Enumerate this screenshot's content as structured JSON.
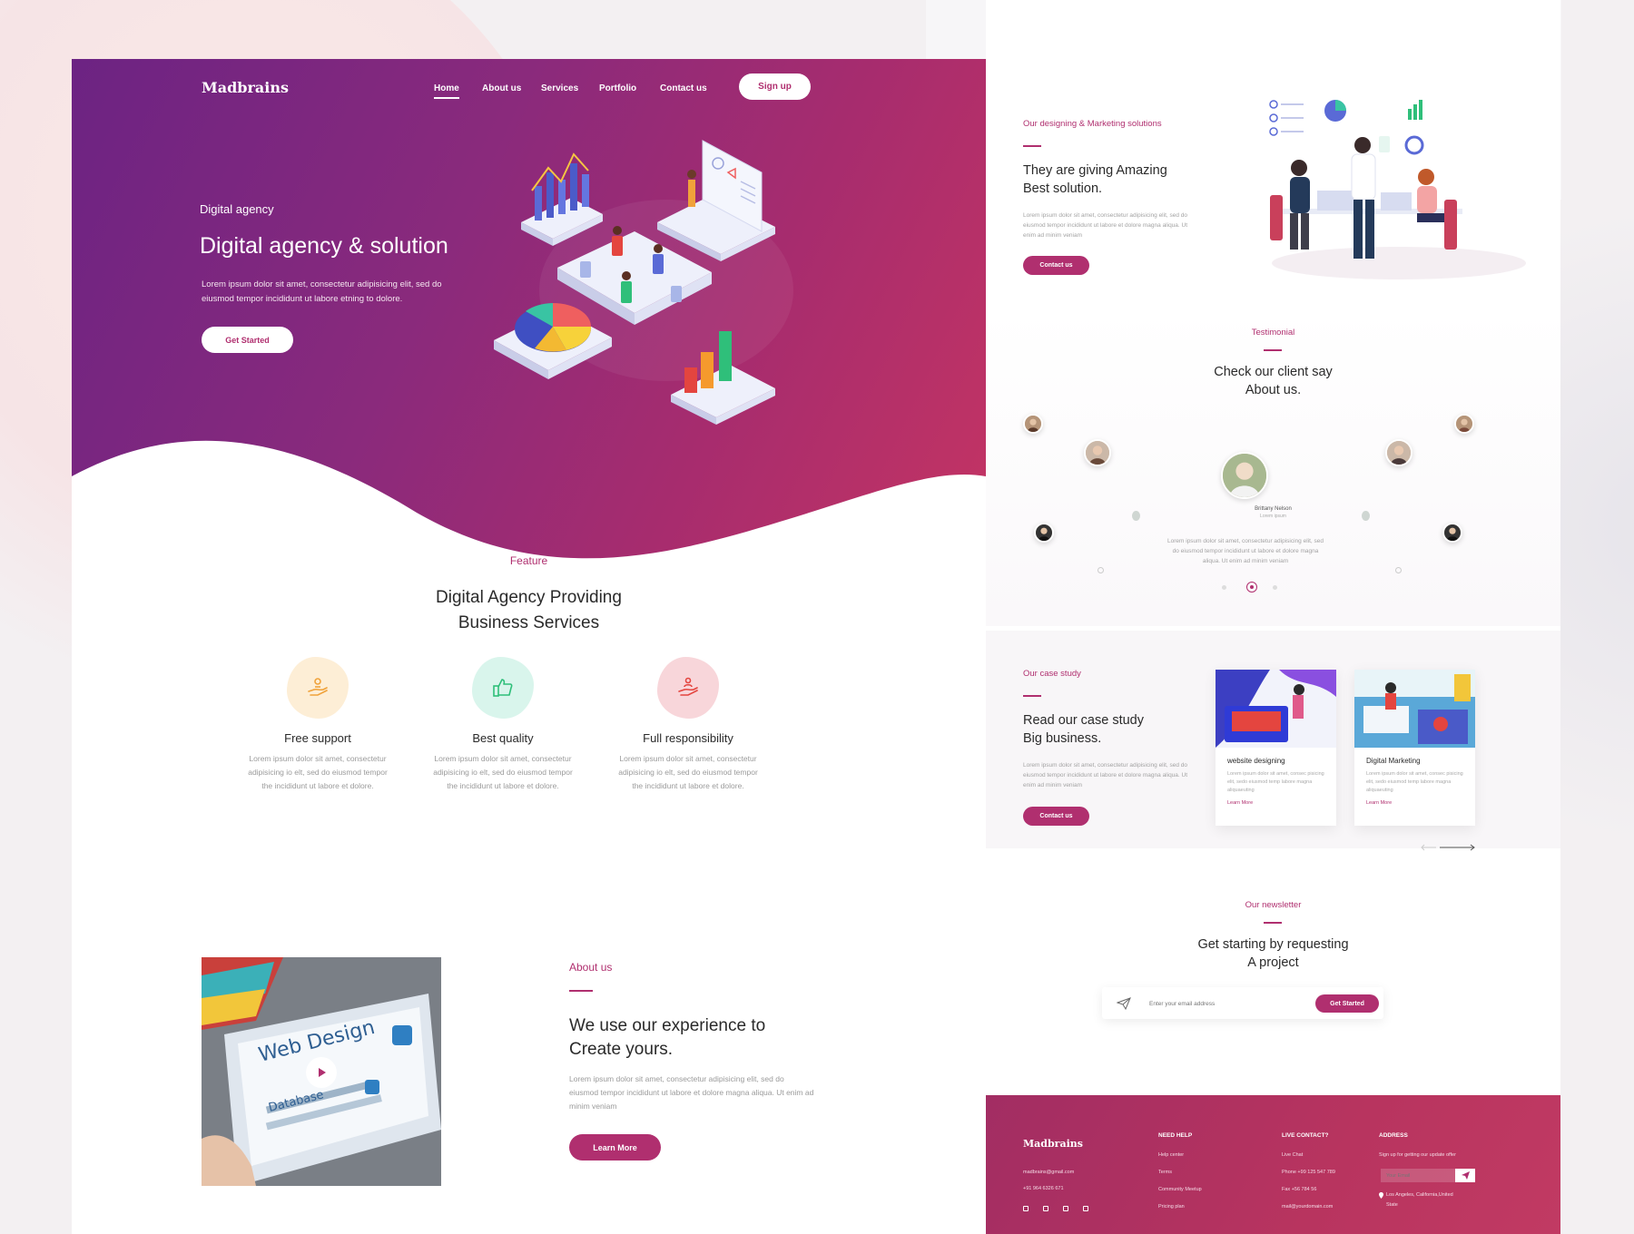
{
  "left_page": {
    "brand": "Madbrains",
    "nav": [
      {
        "label": "Home",
        "active": true
      },
      {
        "label": "About us",
        "active": false
      },
      {
        "label": "Services",
        "active": false
      },
      {
        "label": "Portfolio",
        "active": false
      },
      {
        "label": "Contact us",
        "active": false
      }
    ],
    "signup_label": "Sign up",
    "hero": {
      "eyebrow": "Digital agency",
      "title": "Digital agency & solution",
      "description": "Lorem ipsum dolor sit amet, consectetur adipisicing elit, sed do eiusmod tempor incididunt ut labore etning to dolore.",
      "button_label": "Get Started"
    },
    "feature": {
      "eyebrow": "Feature",
      "title_line1": "Digital Agency Providing",
      "title_line2": "Business Services",
      "items": [
        {
          "title": "Free support",
          "description": "Lorem ipsum dolor sit amet, consectetur adipisicing io elt, sed do eiusmod tempor the incididunt ut labore et dolore.",
          "icon": "support-hand-icon",
          "color": "#fdeed6"
        },
        {
          "title": "Best quality",
          "description": "Lorem ipsum dolor sit amet, consectetur adipisicing io elt, sed do eiusmod tempor the incididunt ut labore et dolore.",
          "icon": "thumbs-up-icon",
          "color": "#d9f5ec"
        },
        {
          "title": "Full responsibility",
          "description": "Lorem ipsum dolor sit amet, consectetur adipisicing io elt, sed do eiusmod tempor the incididunt ut labore et dolore.",
          "icon": "responsibility-hand-icon",
          "color": "#f8d6da"
        }
      ]
    },
    "about": {
      "eyebrow": "About us",
      "title_line1": "We use our experience to",
      "title_line2": "Create yours.",
      "description": "Lorem ipsum dolor sit amet, consectetur adipisicing elit, sed do eiusmod tempor incididunt ut labore et dolore magna aliqua. Ut enim ad minim veniam",
      "button_label": "Learn More",
      "image_text_1": "Web Design",
      "image_text_2": "Database"
    }
  },
  "right_page": {
    "solutions": {
      "eyebrow": "Our designing & Marketing solutions",
      "title_line1": "They are giving Amazing",
      "title_line2": "Best solution.",
      "description": "Lorem ipsum dolor sit amet, consectetur adipisicing elit, sed do eiusmod tempor incididunt ut labore et dolore magna aliqua. Ut enim ad minim veniam",
      "button_label": "Contact us"
    },
    "testimonial": {
      "eyebrow": "Testimonial",
      "title_line1": "Check our client say",
      "title_line2": "About us.",
      "name": "Brittany Nelson",
      "role": "Lorem ipsum",
      "quote": "Lorem ipsum dolor sit amet, consectetur adipisicing elit, sed do eiusmod tempor incididunt ut labore et dolore magna aliqua. Ut enim ad minim veniam"
    },
    "case_study": {
      "eyebrow": "Our case study",
      "title_line1": "Read our case study",
      "title_line2": "Big business.",
      "description": "Lorem ipsum dolor sit amet, consectetur adipisicing elit, sed do eiusmod tempor incididunt ut labore et dolore magna aliqua. Ut enim ad minim veniam",
      "button_label": "Contact us",
      "cards": [
        {
          "title": "website designing",
          "description": "Lorem ipsum dolor sit amet, consec pisicing elit, sedo eiusmod temp labore magna aliquaeuting",
          "link": "Learn More"
        },
        {
          "title": "Digital Marketing",
          "description": "Lorem ipsum dolor sit amet, consec pisicing elit, sedo eiusmod temp labore magna aliquaeuting",
          "link": "Learn More"
        }
      ]
    },
    "newsletter": {
      "eyebrow": "Our newsletter",
      "title_line1": "Get starting by requesting",
      "title_line2": "A project",
      "placeholder": "Enter your email address",
      "button_label": "Get Started"
    },
    "footer": {
      "brand": "Madbrains",
      "email": "madbrains@gmail.com",
      "phone": "+91 964 6326 671",
      "need_help_heading": "NEED HELP",
      "need_help_links": [
        "Help center",
        "Terms",
        "Community Meetup",
        "Pricing plan"
      ],
      "live_contact_heading": "LIVE CONTACT?",
      "live_contact_items": [
        "Live Chat",
        "Phone +99 125 547 789",
        "Fax +56 784 56",
        "mail@yourdomain.com"
      ],
      "address_heading": "ADDRESS",
      "address_signup": "Sign up for getting our update offer",
      "email_placeholder": "Your Email",
      "address_line1": "Los Angeles, California,United",
      "address_line2": "State"
    }
  }
}
